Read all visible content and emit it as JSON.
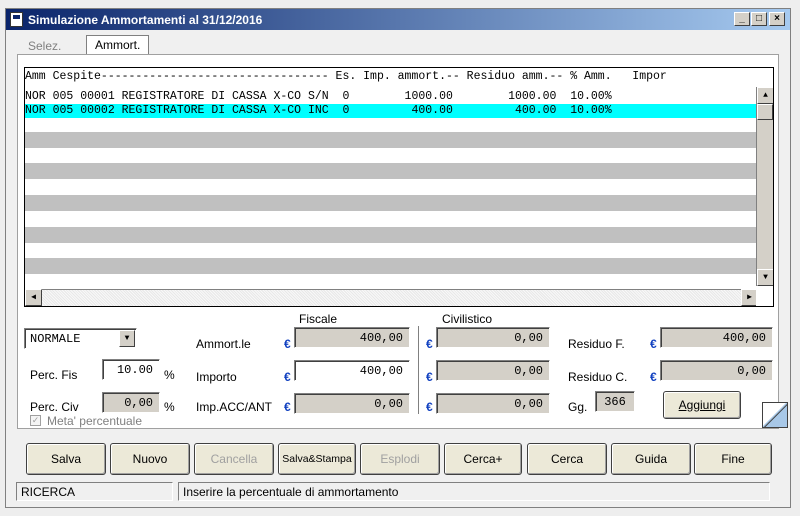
{
  "window": {
    "title": "Simulazione Ammortamenti al 31/12/2016",
    "minimize_glyph": "_",
    "maximize_glyph": "□",
    "close_glyph": "×"
  },
  "tabs": [
    {
      "label": "Selez.",
      "active": false
    },
    {
      "label": "Ammort.",
      "active": true
    }
  ],
  "grid": {
    "header": "Amm Cespite--------------------------------- Es. Imp. ammort.-- Residuo amm.-- % Amm.   Impor",
    "rows": [
      {
        "text": "NOR 005 00001 REGISTRATORE DI CASSA X-CO S/N  0        1000.00        1000.00  10.00%",
        "selected": false
      },
      {
        "text": "NOR 005 00002 REGISTRATORE DI CASSA X-CO INC  0         400.00         400.00  10.00%",
        "selected": true
      }
    ],
    "scroll_up": "▲",
    "scroll_down": "▼",
    "scroll_left": "◀",
    "scroll_right": "▶"
  },
  "form": {
    "type_select": "NORMALE",
    "select_arrow": "▼",
    "perc_fis_label": "Perc. Fis",
    "perc_fis_value": "10.00",
    "perc_civ_label": "Perc. Civ",
    "perc_civ_value": "0,00",
    "percent_sign": "%",
    "meta_checkbox_label": "Meta' percentuale",
    "meta_checked": true,
    "fiscale_header": "Fiscale",
    "civilistico_header": "Civilistico",
    "euro": "€",
    "ammortle_label": "Ammort.le",
    "importo_label": "Importo",
    "impaccant_label": "Imp.ACC/ANT",
    "fiscale_ammortle": "400,00",
    "fiscale_importo": "400,00",
    "fiscale_impaccant": "0,00",
    "civ_ammortle": "0,00",
    "civ_importo": "0,00",
    "civ_impaccant": "0,00",
    "residuo_f_label": "Residuo F.",
    "residuo_f_value": "400,00",
    "residuo_c_label": "Residuo C.",
    "residuo_c_value": "0,00",
    "gg_label": "Gg.",
    "gg_value": "366",
    "aggiungi_label": "Aggiungi"
  },
  "buttons": [
    {
      "name": "salva-button",
      "label": "Salva",
      "enabled": true
    },
    {
      "name": "nuovo-button",
      "label": "Nuovo",
      "enabled": true
    },
    {
      "name": "cancella-button",
      "label": "Cancella",
      "enabled": false
    },
    {
      "name": "salva-stampa-button",
      "label": "Salva&Stampa",
      "enabled": true
    },
    {
      "name": "esplodi-button",
      "label": "Esplodi",
      "enabled": false
    },
    {
      "name": "cerca-plus-button",
      "label": "Cerca+",
      "enabled": true
    },
    {
      "name": "cerca-button",
      "label": "Cerca",
      "enabled": true
    },
    {
      "name": "guida-button",
      "label": "Guida",
      "enabled": true
    },
    {
      "name": "fine-button",
      "label": "Fine",
      "enabled": true
    }
  ],
  "status": {
    "mode": "RICERCA",
    "message": "Inserire la percentuale di ammortamento"
  }
}
